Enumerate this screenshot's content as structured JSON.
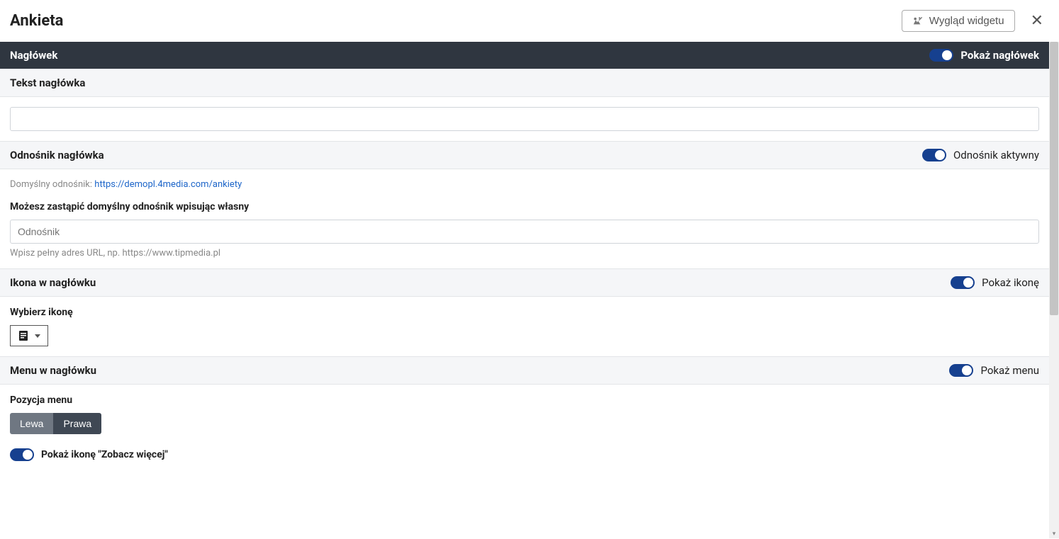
{
  "header": {
    "title": "Ankieta",
    "appearance_button": "Wygląd widgetu"
  },
  "sections": {
    "naglowek": {
      "title": "Nagłówek",
      "toggle_label": "Pokaż nagłówek"
    },
    "tekst_naglowka": {
      "title": "Tekst nagłówka",
      "value": ""
    },
    "odnosnik": {
      "title": "Odnośnik nagłówka",
      "toggle_label": "Odnośnik aktywny",
      "default_label": "Domyślny odnośnik:",
      "default_url": "https://demopl.4media.com/ankiety",
      "replace_label": "Możesz zastąpić domyślny odnośnik wpisując własny",
      "input_placeholder": "Odnośnik",
      "hint": "Wpisz pełny adres URL, np. https://www.tipmedia.pl"
    },
    "ikona": {
      "title": "Ikona w nagłówku",
      "toggle_label": "Pokaż ikonę",
      "choose_label": "Wybierz ikonę"
    },
    "menu": {
      "title": "Menu w nagłówku",
      "toggle_label": "Pokaż menu",
      "position_label": "Pozycja menu",
      "options": {
        "left": "Lewa",
        "right": "Prawa"
      },
      "show_more_icon_label": "Pokaż ikonę \"Zobacz więcej\""
    }
  }
}
